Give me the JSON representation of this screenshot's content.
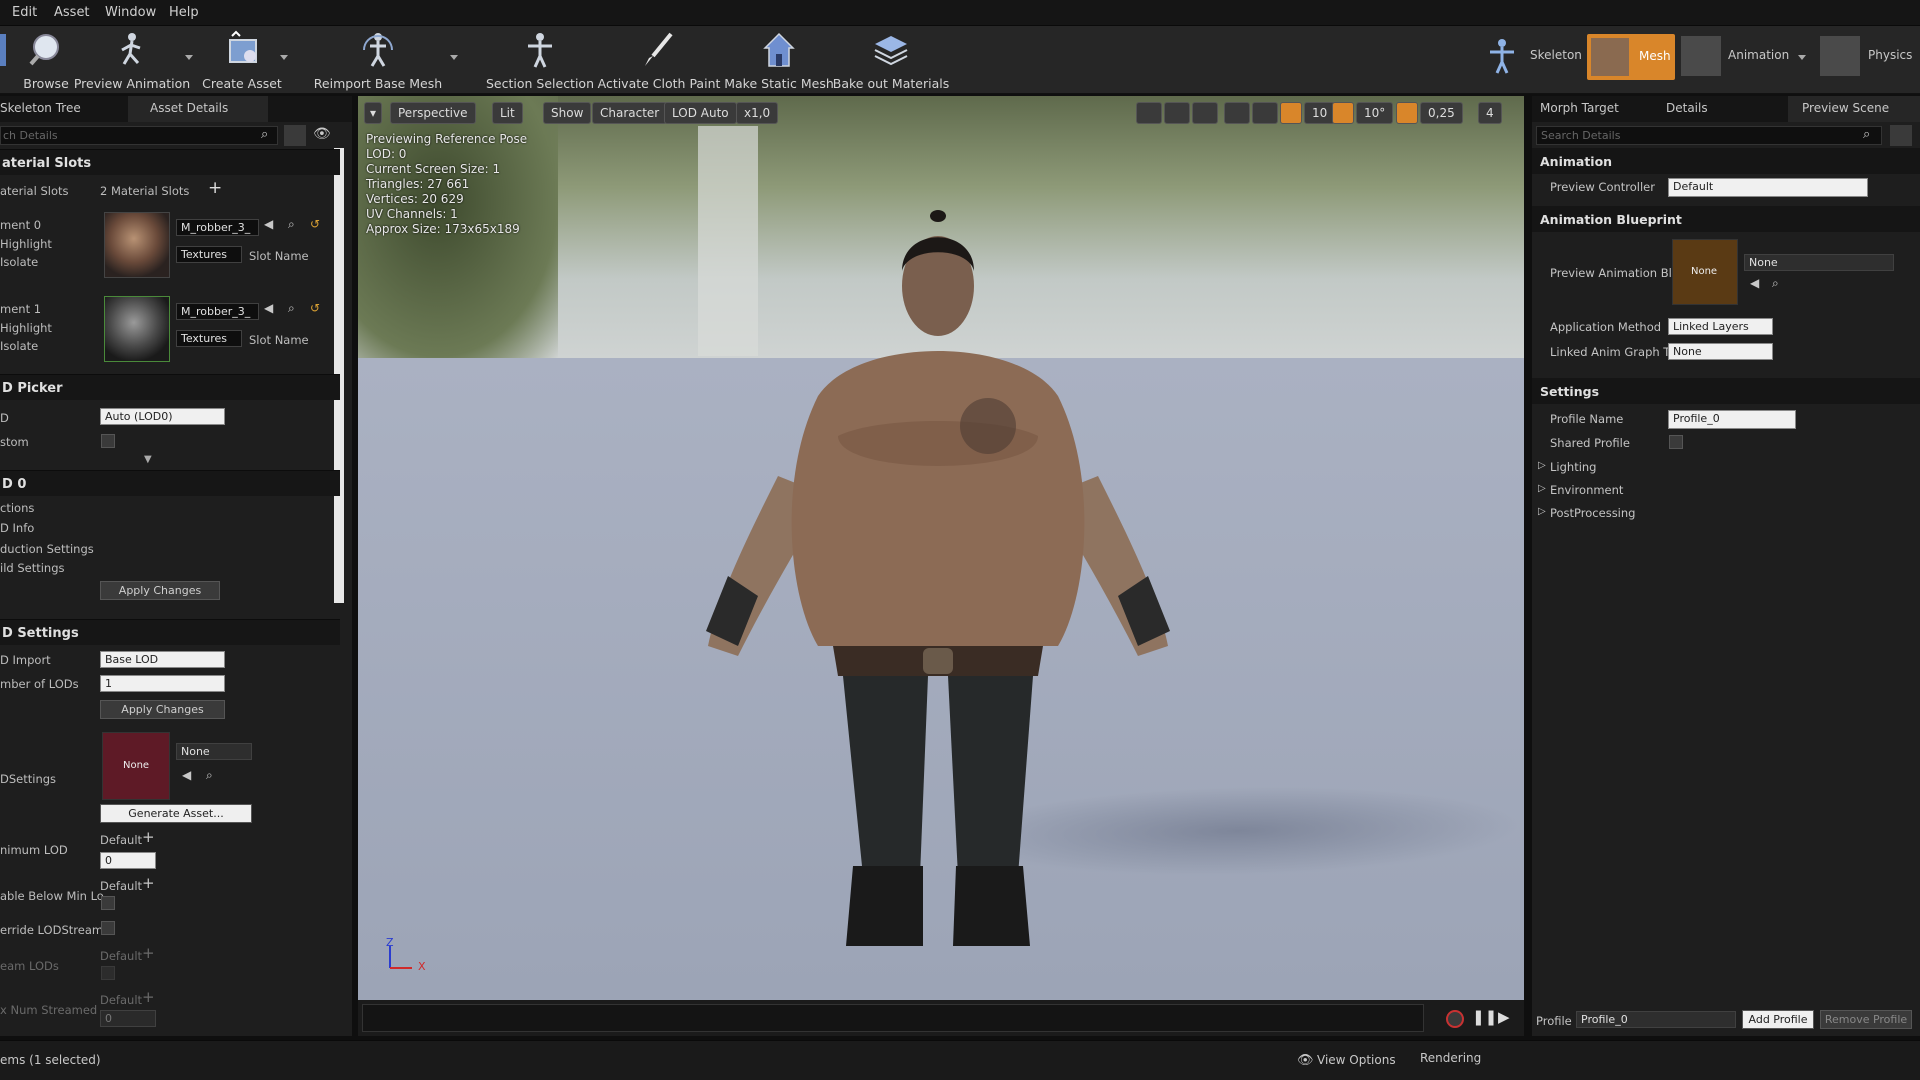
{
  "menu": [
    "Edit",
    "Asset",
    "Window",
    "Help"
  ],
  "toolbar": {
    "browse": "Browse",
    "preview_animation": "Preview Animation",
    "create_asset": "Create Asset",
    "reimport": "Reimport Base Mesh",
    "section_selection": "Section Selection",
    "cloth_paint": "Activate Cloth Paint",
    "static_mesh": "Make Static Mesh",
    "bake_materials": "Bake out Materials",
    "skeleton": "Skeleton",
    "mesh": "Mesh",
    "animation": "Animation",
    "physics": "Physics"
  },
  "left_panel": {
    "tab_skeleton": "Skeleton Tree",
    "tab_details": "Asset Details",
    "search_placeholder": "ch Details",
    "material_slots_header": "aterial Slots",
    "material_slots_label": "aterial Slots",
    "material_slots_value": "2 Material Slots",
    "element0": "ment 0",
    "element1": "ment 1",
    "highlight": "Highlight",
    "isolate": "Isolate",
    "material_name": "M_robber_3_",
    "textures": "Textures",
    "slot_name": "Slot Name",
    "lod_picker_header": "D Picker",
    "lod_label": "D",
    "lod_value": "Auto (LOD0)",
    "custom_label": "stom",
    "lod0_header": "D 0",
    "sections": "ctions",
    "lod_info": "D Info",
    "reduction": "duction Settings",
    "build": "ild Settings",
    "apply_changes": "Apply Changes",
    "lod_settings_header": "D Settings",
    "lod_import": "D Import",
    "lod_import_value": "Base LOD",
    "number_of_lods": "mber of LODs",
    "number_of_lods_value": "1",
    "apply_changes2": "Apply Changes",
    "dsettings": "DSettings",
    "none": "None",
    "none_combo": "None",
    "generate_asset": "Generate Asset...",
    "minimum_lod": "nimum LOD",
    "default": "Default",
    "min_lod_value": "0",
    "disable_below": "able Below Min Lo",
    "override_stream": "erride LODStreami",
    "stream_lods": "eam LODs",
    "max_streamed": "x Num Streamed",
    "max_streamed_value": "0"
  },
  "viewport": {
    "perspective": "Perspective",
    "lit": "Lit",
    "show": "Show",
    "character": "Character",
    "lod_auto": "LOD Auto",
    "speed": "x1,0",
    "grid_snap": "10",
    "rot_snap": "10°",
    "scale_snap": "0,25",
    "cam_speed": "4",
    "info": [
      "Previewing Reference Pose",
      "LOD: 0",
      "Current Screen Size: 1",
      "Triangles: 27 661",
      "Vertices: 20 629",
      "UV Channels: 1",
      "Approx Size: 173x65x189"
    ],
    "axis_z": "Z",
    "axis_x": "X"
  },
  "right_panel": {
    "tab_morph": "Morph Target",
    "tab_details": "Details",
    "tab_preview": "Preview Scene",
    "search_placeholder": "Search Details",
    "animation_header": "Animation",
    "preview_controller": "Preview Controller",
    "preview_controller_value": "Default",
    "anim_bp_header": "Animation Blueprint",
    "preview_anim_bp": "Preview Animation Bl",
    "none_thumb": "None",
    "none_combo": "None",
    "application_method": "Application Method",
    "application_method_value": "Linked Layers",
    "linked_anim": "Linked Anim Graph Ta",
    "linked_anim_value": "None",
    "settings_header": "Settings",
    "profile_name": "Profile Name",
    "profile_name_value": "Profile_0",
    "shared_profile": "Shared Profile",
    "lighting": "Lighting",
    "environment": "Environment",
    "postprocessing": "PostProcessing",
    "profile_label": "Profile",
    "profile_value": "Profile_0",
    "add_profile": "Add Profile",
    "remove_profile": "Remove Profile"
  },
  "status": {
    "items_selected": "ems (1 selected)",
    "view_options": "View Options",
    "rendering": "Rendering"
  },
  "colors": {
    "accent_orange": "#d9862a",
    "panel": "#1e1e1e",
    "viewport_floor": "#9ea6b8"
  }
}
